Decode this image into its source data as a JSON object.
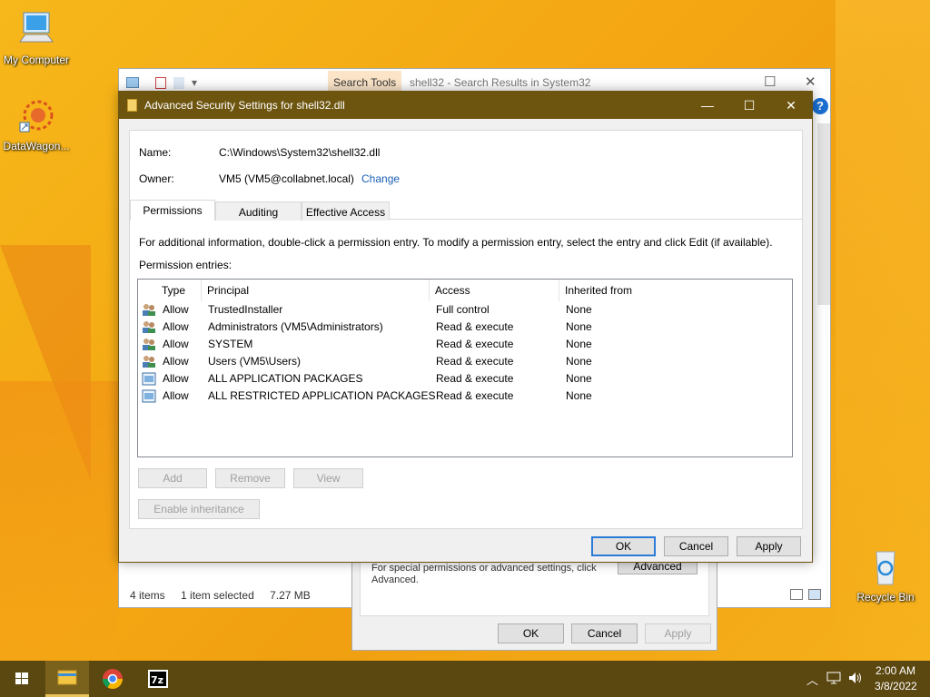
{
  "desktop": {
    "icons": [
      {
        "label": "My Computer"
      },
      {
        "label": "DataWagon..."
      },
      {
        "label": "Recycle Bin"
      }
    ]
  },
  "explorer": {
    "search_tools": "Search Tools",
    "title": "shell32 - Search Results in System32",
    "status_items": "4 items",
    "status_selected": "1 item selected",
    "status_size": "7.27 MB"
  },
  "props_dialog": {
    "text": "For special permissions or advanced settings, click Advanced.",
    "advanced_label": "Advanced",
    "ok_label": "OK",
    "cancel_label": "Cancel",
    "apply_label": "Apply"
  },
  "dialog": {
    "title": "Advanced Security Settings for shell32.dll",
    "name_label": "Name:",
    "name_value": "C:\\Windows\\System32\\shell32.dll",
    "owner_label": "Owner:",
    "owner_value": "VM5 (VM5@collabnet.local)",
    "change_label": "Change",
    "tabs": [
      {
        "label": "Permissions"
      },
      {
        "label": "Auditing"
      },
      {
        "label": "Effective Access"
      }
    ],
    "info_text": "For additional information, double-click a permission entry. To modify a permission entry, select the entry and click Edit (if available).",
    "entries_label": "Permission entries:",
    "columns": [
      "Type",
      "Principal",
      "Access",
      "Inherited from"
    ],
    "rows": [
      {
        "icon": "users-icon",
        "type": "Allow",
        "principal": "TrustedInstaller",
        "access": "Full control",
        "inherited": "None"
      },
      {
        "icon": "users-icon",
        "type": "Allow",
        "principal": "Administrators (VM5\\Administrators)",
        "access": "Read & execute",
        "inherited": "None"
      },
      {
        "icon": "users-icon",
        "type": "Allow",
        "principal": "SYSTEM",
        "access": "Read & execute",
        "inherited": "None"
      },
      {
        "icon": "users-icon",
        "type": "Allow",
        "principal": "Users (VM5\\Users)",
        "access": "Read & execute",
        "inherited": "None"
      },
      {
        "icon": "app-package-icon",
        "type": "Allow",
        "principal": "ALL APPLICATION PACKAGES",
        "access": "Read & execute",
        "inherited": "None"
      },
      {
        "icon": "app-package-icon",
        "type": "Allow",
        "principal": "ALL RESTRICTED APPLICATION PACKAGES",
        "access": "Read & execute",
        "inherited": "None"
      }
    ],
    "add_label": "Add",
    "remove_label": "Remove",
    "view_label": "View",
    "enable_inheritance_label": "Enable inheritance",
    "ok_label": "OK",
    "cancel_label": "Cancel",
    "apply_label": "Apply"
  },
  "taskbar": {
    "time": "2:00 AM",
    "date": "3/8/2022"
  },
  "colors": {
    "title_bar": "#6e550f",
    "taskbar": "#5b4710",
    "link": "#1a5fb4",
    "focus_border": "#2b7bd6"
  }
}
